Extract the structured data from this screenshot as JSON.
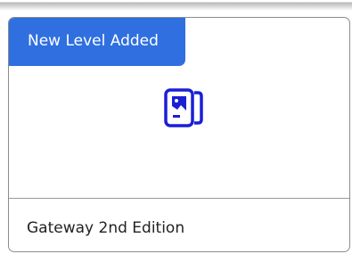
{
  "card": {
    "badge_label": "New Level Added",
    "icon": "book-image-icon",
    "title": "Gateway 2nd Edition"
  },
  "colors": {
    "badge_bg": "#2f6fe0",
    "icon_color": "#1a1fd6",
    "border": "#8c8c8c"
  }
}
